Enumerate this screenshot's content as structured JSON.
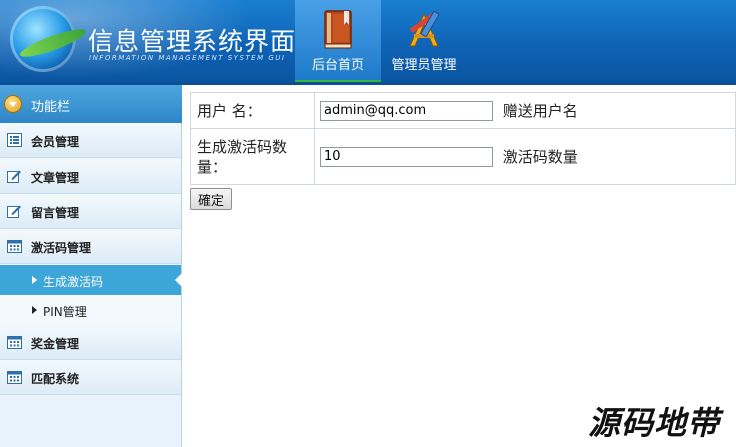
{
  "header": {
    "title": "信息管理系统界面",
    "subtitle": "INFORMATION MANAGEMENT SYSTEM GUI",
    "nav": [
      {
        "label": "后台首页",
        "icon": "book-icon",
        "active": true
      },
      {
        "label": "管理员管理",
        "icon": "tools-icon",
        "active": false
      }
    ]
  },
  "sidebar": {
    "title": "功能栏",
    "items": [
      {
        "label": "会员管理",
        "icon": "list-icon"
      },
      {
        "label": "文章管理",
        "icon": "edit-icon"
      },
      {
        "label": "留言管理",
        "icon": "edit-icon"
      },
      {
        "label": "激活码管理",
        "icon": "calendar-icon"
      }
    ],
    "subitems": [
      {
        "label": "生成激活码",
        "active": true
      },
      {
        "label": "PIN管理",
        "active": false
      }
    ],
    "items_after": [
      {
        "label": "奖金管理",
        "icon": "calendar-icon"
      },
      {
        "label": "匹配系统",
        "icon": "calendar-icon"
      }
    ]
  },
  "form": {
    "username_label": "用户 名：",
    "username_value": "admin@qq.com",
    "username_hint": "赠送用户名",
    "count_label": "生成激活码数量：",
    "count_value": "10",
    "count_hint": "激活码数量",
    "submit_label": "確定"
  },
  "watermark": "源码地带",
  "colors": {
    "header_blue": "#0e62b5",
    "active_green": "#38b63d",
    "sidebar_active": "#3ca6d8"
  }
}
